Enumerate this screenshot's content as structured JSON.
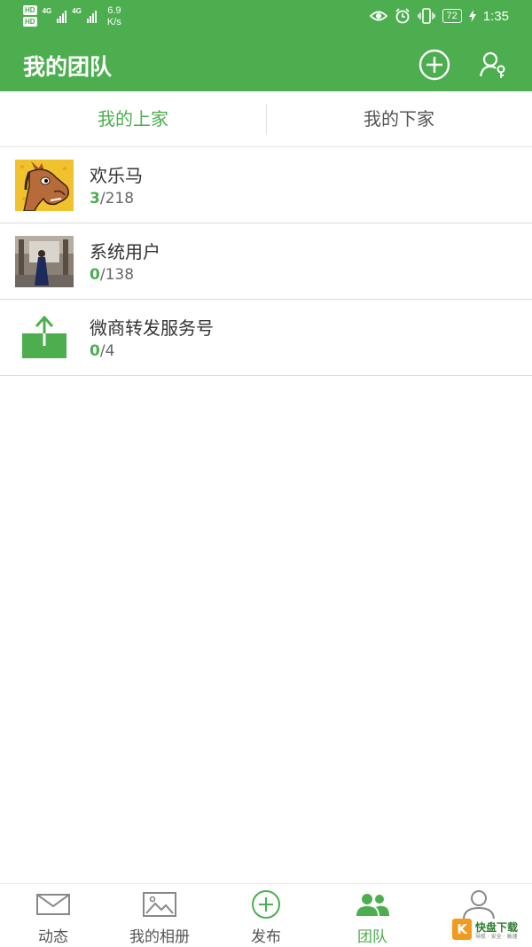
{
  "status_bar": {
    "hd1": "HD",
    "hd2": "HD",
    "net1": "4G",
    "net2": "4G",
    "speed_value": "6.9",
    "speed_unit": "K/s",
    "battery": "72",
    "time": "1:35"
  },
  "app_bar": {
    "title": "我的团队",
    "add_icon": "plus-circle-icon",
    "user_icon": "user-key-icon"
  },
  "tabs": [
    {
      "label": "我的上家",
      "active": true
    },
    {
      "label": "我的下家",
      "active": false
    }
  ],
  "members": [
    {
      "name": "欢乐马",
      "count_left": "3",
      "count_right": "/218",
      "avatar": "horse-cartoon"
    },
    {
      "name": "系统用户",
      "count_left": "0",
      "count_right": "/138",
      "avatar": "person-photo"
    },
    {
      "name": "微商转发服务号",
      "count_left": "0",
      "count_right": "/4",
      "avatar": "upload-icon"
    }
  ],
  "bottom_nav": [
    {
      "label": "动态",
      "icon": "envelope-icon",
      "active": false
    },
    {
      "label": "我的相册",
      "icon": "image-icon",
      "active": false
    },
    {
      "label": "发布",
      "icon": "plus-circle-icon",
      "active": false
    },
    {
      "label": "团队",
      "icon": "team-icon",
      "active": true
    },
    {
      "label": "",
      "icon": "profile-icon",
      "active": false
    }
  ],
  "watermark": {
    "brand": "快盘下载",
    "tagline": "导航 · 安全 · 高速"
  },
  "colors": {
    "primary": "#4cae4f",
    "text": "#333333",
    "muted": "#666666"
  }
}
